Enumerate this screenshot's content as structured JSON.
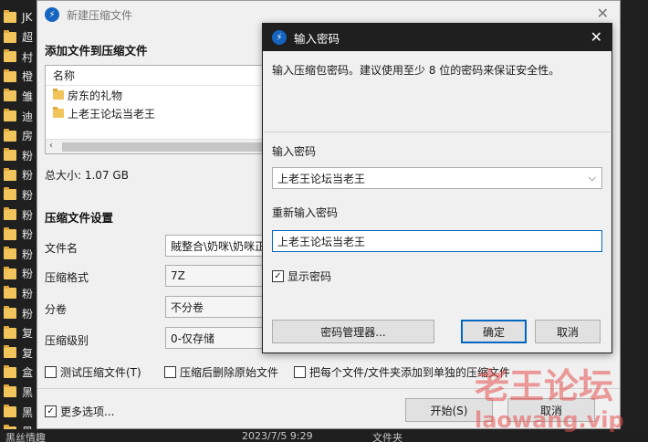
{
  "background": {
    "list_items": [
      "JK",
      "超",
      "村",
      "橙",
      "雏",
      "迪",
      "房",
      "粉",
      "粉",
      "粉",
      "粉",
      "粉",
      "粉",
      "粉",
      "粉",
      "粉",
      "复",
      "复",
      "盒",
      "黑",
      "黑",
      "黑"
    ],
    "bottom": {
      "name": "黑丝情趣",
      "date": "2023/7/5 9:29",
      "type": "文件夹"
    }
  },
  "main_dialog": {
    "title": "新建压缩文件",
    "add_files_title": "添加文件到压缩文件",
    "file_list": {
      "header": "名称",
      "items": [
        "房东的礼物",
        "上老王论坛当老王"
      ]
    },
    "total_size": "总大小: 1.07 GB",
    "settings_title": "压缩文件设置",
    "settings": {
      "filename_label": "文件名",
      "filename_value": "賊整合\\奶咪\\奶咪正",
      "format_label": "压缩格式",
      "format_value": "7Z",
      "split_label": "分卷",
      "split_value": "不分卷",
      "level_label": "压缩级别",
      "level_value": "0-仅存储"
    },
    "options": {
      "test": "测试压缩文件(T)",
      "delete_after": "压缩后删除原始文件",
      "add_each": "把每个文件/文件夹添加到单独的压缩文件"
    },
    "more_options": "更多选项...",
    "start_button": "开始(S)",
    "cancel_button": "取消"
  },
  "password_dialog": {
    "title": "输入密码",
    "description": "输入压缩包密码。建议使用至少 8 位的密码来保证安全性。",
    "password_label": "输入密码",
    "password_value": "上老王论坛当老王",
    "confirm_label": "重新输入密码",
    "confirm_value": "上老王论坛当老王",
    "show_password": "显示密码",
    "manager_button": "密码管理器...",
    "ok_button": "确定",
    "cancel_button": "取消"
  },
  "watermark": {
    "line1": "老王论坛",
    "line2": "laowang.vip"
  }
}
